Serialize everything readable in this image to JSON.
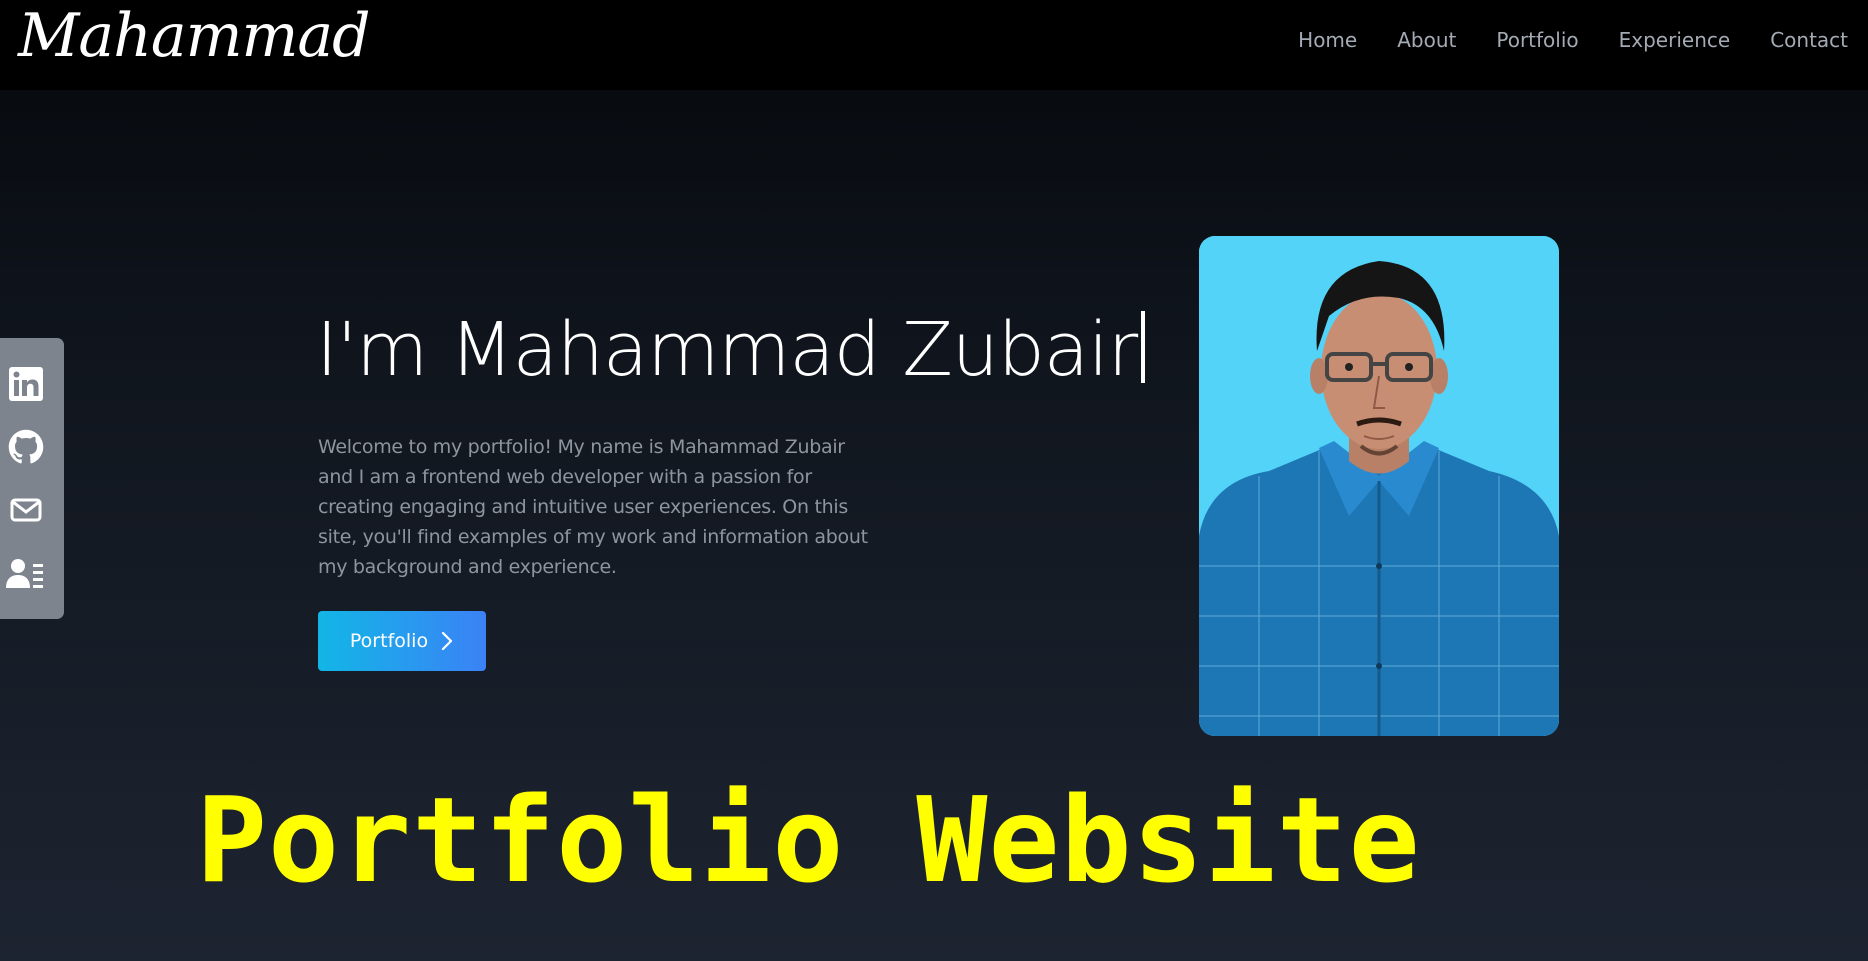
{
  "header": {
    "logo": "Mahammad",
    "nav": [
      "Home",
      "About",
      "Portfolio",
      "Experience",
      "Contact"
    ]
  },
  "social": {
    "icons": [
      "linkedin-icon",
      "github-icon",
      "mail-icon",
      "contact-card-icon"
    ]
  },
  "hero": {
    "title": "I'm Mahammad Zubair",
    "intro": "Welcome to my portfolio! My name is Mahammad Zubair and I am a frontend web developer with a passion for creating engaging and intuitive user experiences. On this site, you'll find examples of my work and information about my background and experience.",
    "button_label": "Portfolio"
  },
  "overlay": {
    "title": "Portfolio Website"
  },
  "colors": {
    "overlay_text": "#ffff00",
    "button_gradient_start": "#12b6e6",
    "button_gradient_end": "#3b82f6",
    "photo_background": "#53d3f8",
    "social_bar": "#7e848e"
  }
}
